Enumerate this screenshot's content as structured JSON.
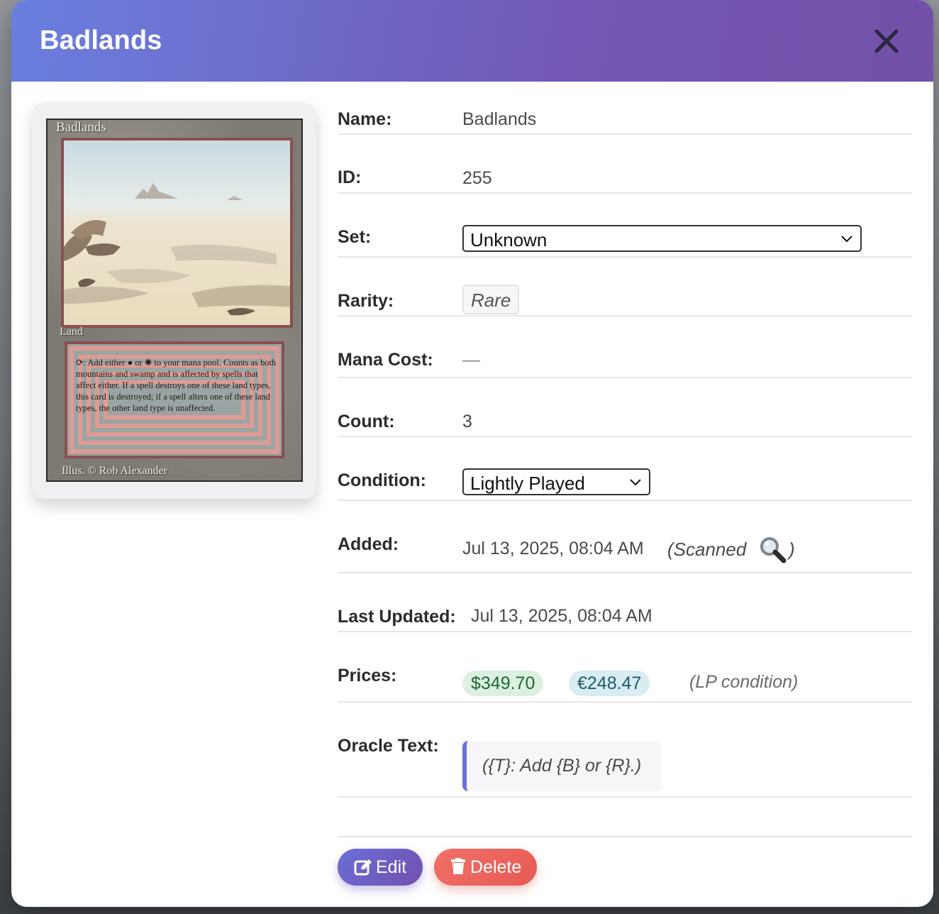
{
  "modal": {
    "title": "Badlands",
    "close_icon": "close-icon"
  },
  "card_image": {
    "name": "Badlands",
    "type": "Land",
    "rules_text": "⟳: Add either ● or ✺ to your mana pool. Counts as both mountains and swamp and is affected by spells that affect either. If a spell destroys one of these land types, this card is destroyed; if a spell alters one of these land types, the other land type is unaffected.",
    "illustrator": "Illus. © Rob Alexander"
  },
  "details": {
    "name": {
      "label": "Name:",
      "value": "Badlands"
    },
    "id": {
      "label": "ID:",
      "value": "255"
    },
    "set": {
      "label": "Set:",
      "selected": "Unknown"
    },
    "rarity": {
      "label": "Rarity:",
      "value": "Rare"
    },
    "mana_cost": {
      "label": "Mana Cost:",
      "value": "—"
    },
    "count": {
      "label": "Count:",
      "value": "3"
    },
    "condition": {
      "label": "Condition:",
      "selected": "Lightly Played"
    },
    "added": {
      "label": "Added:",
      "value": "Jul 13, 2025, 08:04 AM",
      "note": "(Scanned",
      "note_end": ")",
      "icon": "magnifier-icon"
    },
    "last_updated": {
      "label": "Last Updated:",
      "value": "Jul 13, 2025, 08:04 AM"
    },
    "prices": {
      "label": "Prices:",
      "usd": "$349.70",
      "eur": "€248.47",
      "note": "(LP condition)"
    },
    "oracle": {
      "label": "Oracle Text:",
      "value": "({T}: Add {B} or {R}.)"
    }
  },
  "actions": {
    "edit_label": "Edit",
    "delete_label": "Delete"
  },
  "colors": {
    "header_gradient_start": "#6a7fdf",
    "header_gradient_end": "#7350a8",
    "usd_pill_bg": "#dcefe0",
    "eur_pill_bg": "#d8ecf2",
    "edit_button": "#6b5fc8",
    "delete_button": "#e8625c"
  }
}
